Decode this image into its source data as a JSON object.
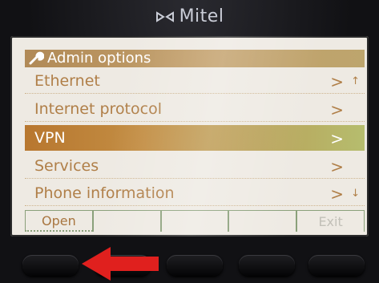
{
  "brand": {
    "name": "Mitel"
  },
  "screen": {
    "header": "Admin options",
    "items": [
      {
        "label": "Ethernet",
        "chevron": ">",
        "scroll": "↑"
      },
      {
        "label": "Internet protocol",
        "chevron": ">"
      },
      {
        "label": "VPN",
        "chevron": ">",
        "selected": true
      },
      {
        "label": "Services",
        "chevron": ">"
      },
      {
        "label": "Phone information",
        "chevron": ">",
        "scroll": "↓"
      }
    ],
    "softkeys": [
      "Open",
      "",
      "",
      "",
      "Exit"
    ]
  },
  "colors": {
    "header": "#c3a06b",
    "selected_row": "#c38e44",
    "item_text": "#b07f48",
    "annotation_arrow": "#e0201e"
  }
}
